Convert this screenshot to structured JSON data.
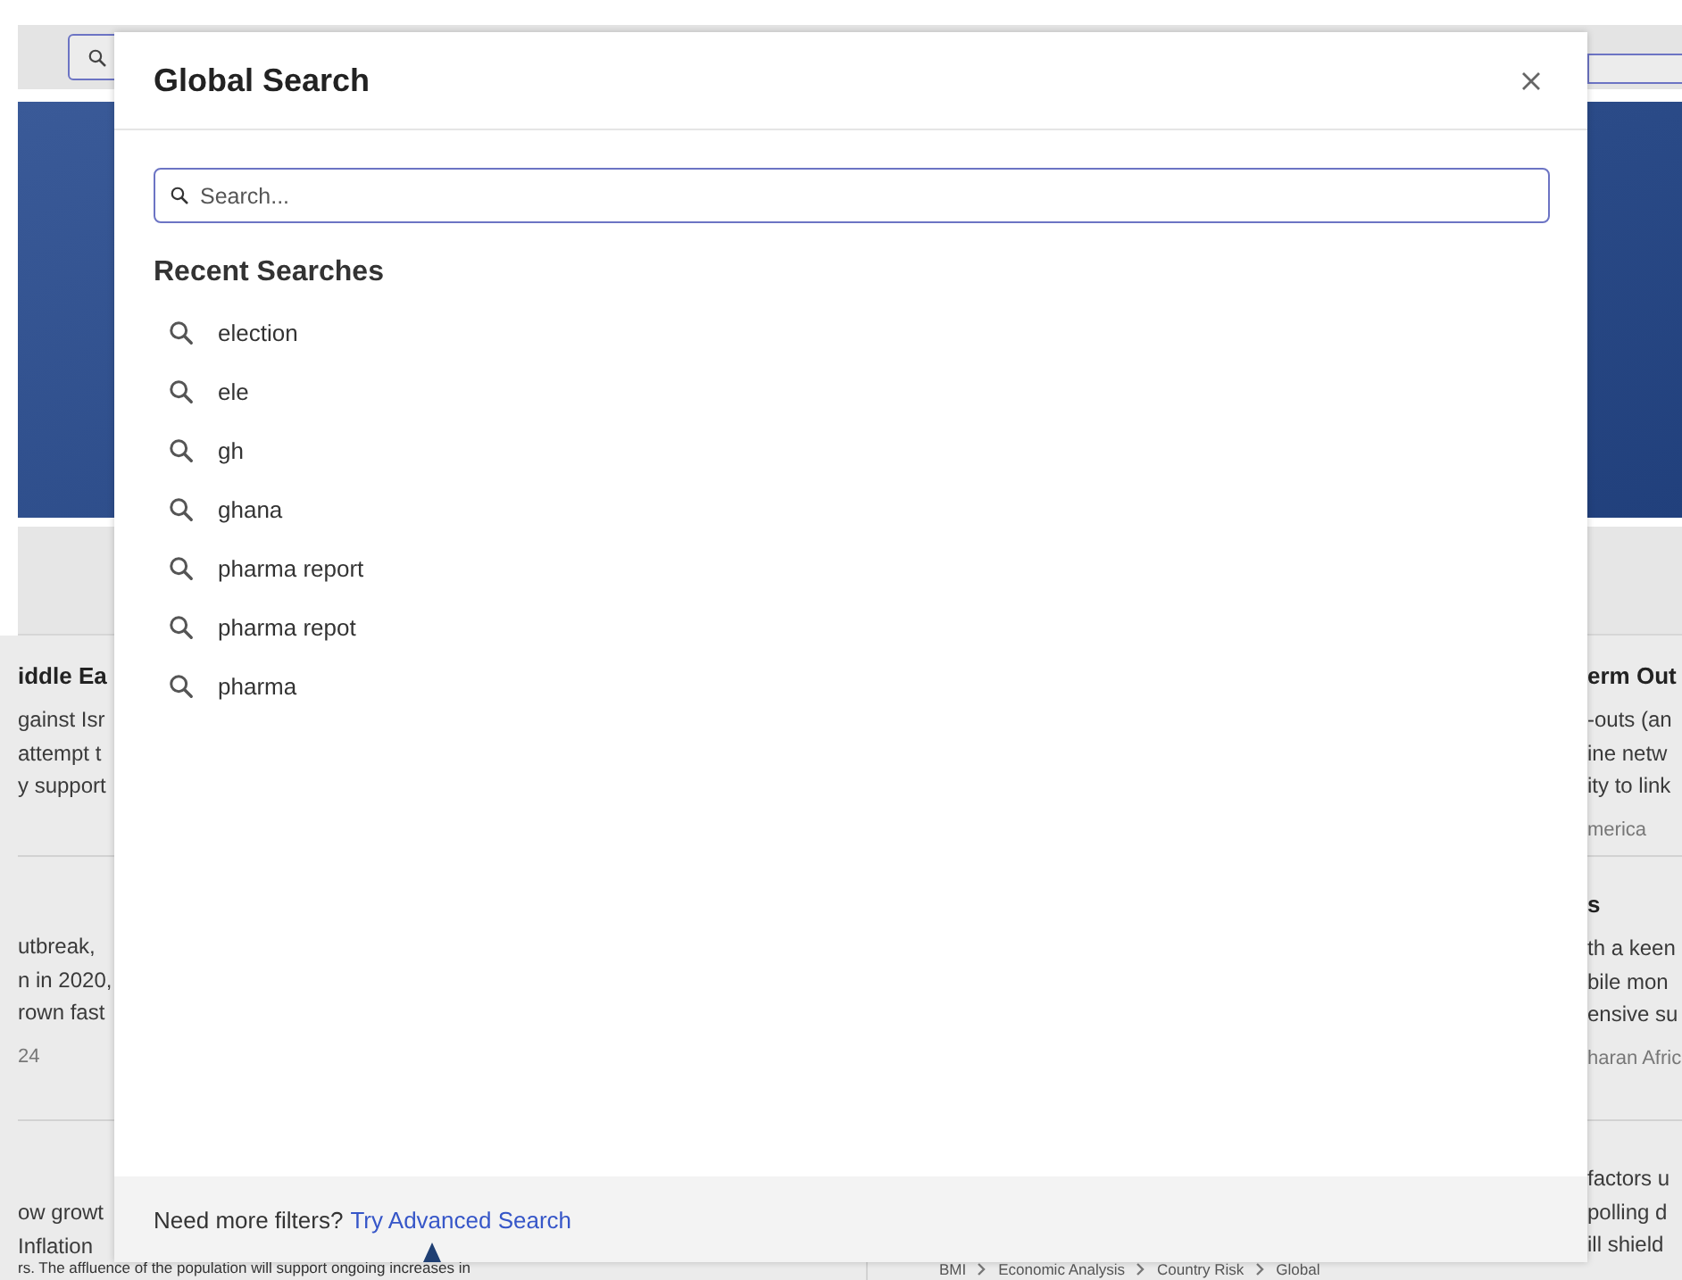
{
  "background": {
    "left_cards": [
      {
        "title": "iddle Ea",
        "lines": [
          "gainst Isr",
          "attempt t",
          "y support"
        ]
      },
      {
        "lines": [
          "utbreak,",
          "n in 2020,",
          "rown fast"
        ],
        "meta": "24"
      },
      {
        "lines": [
          "ow growt",
          "Inflation"
        ]
      }
    ],
    "right_cards": [
      {
        "title": "erm Out",
        "lines": [
          "-outs (an",
          "ine netw",
          "ity to link"
        ],
        "meta": "merica"
      },
      {
        "title": "s",
        "lines": [
          "th a keen",
          "bile mon",
          "ensive su"
        ],
        "meta": "haran Afric"
      },
      {
        "lines": [
          "factors u",
          "polling d",
          "ill shield"
        ]
      }
    ],
    "bottom_text": "rs. The affluence of the population will support ongoing increases in",
    "breadcrumb": [
      "BMI",
      "Economic Analysis",
      "Country Risk",
      "Global"
    ]
  },
  "modal": {
    "title": "Global Search",
    "search": {
      "placeholder": "Search..."
    },
    "recent_heading": "Recent Searches",
    "recent_searches": [
      "election",
      "ele",
      "gh",
      "ghana",
      "pharma report",
      "pharma repot",
      "pharma"
    ],
    "footer": {
      "prompt": "Need more filters?",
      "link": "Try Advanced Search"
    }
  }
}
